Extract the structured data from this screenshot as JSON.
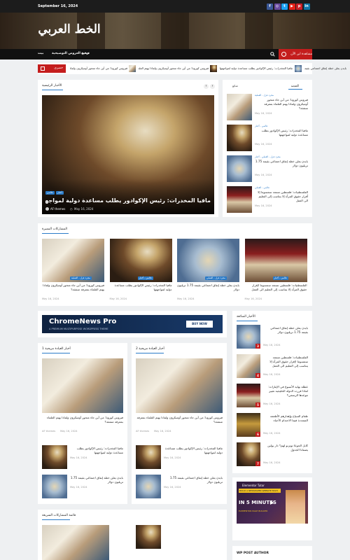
{
  "topbar": {
    "date": "September 16, 2024",
    "social": [
      {
        "icon": "facebook-icon",
        "glyph": "f",
        "color": "#3b5998"
      },
      {
        "icon": "instagram-icon",
        "glyph": "◎",
        "color": "#6a4ba0"
      },
      {
        "icon": "twitter-icon",
        "glyph": "t",
        "color": "#1da1f2"
      },
      {
        "icon": "youtube-icon",
        "glyph": "▶",
        "color": "#e62117"
      },
      {
        "icon": "pinterest-icon",
        "glyph": "p",
        "color": "#cb2027"
      },
      {
        "icon": "linkedin-icon",
        "glyph": "in",
        "color": "#0e76a8"
      }
    ]
  },
  "header": {
    "site_title": "الخط العربي"
  },
  "nav": {
    "items": [
      "بيت",
      "جميع العروض التوضيحية",
      "ترقية"
    ],
    "live_label": "مشاهدة ابن الآن"
  },
  "ticker": {
    "badge": "حصري",
    "items": [
      "فيروس كورونا: من أين جاء متحور أوميكرون ولماذا يهتم العلماء بمعرفة منشئه؟",
      "مافيا المخدرات: رئيس الإكوادور يطلب مساعدة دولية لمواجهتها",
      "بايدن يعلن خطة إنفاق اجتماعي بقيمة 1.75 تريليون دولار"
    ]
  },
  "main_news": {
    "section_title": "الأخبار الرئيسية",
    "categories": [
      "عالمي",
      "أخبار"
    ],
    "headline": "مافيا المخدرات: رئيس الإكوادور يطلب مساعدة دولية لمواجهتها",
    "author": "AF themes",
    "date": "May 16, 2024"
  },
  "tabs": {
    "labels": [
      "شائع",
      "أحدث"
    ],
    "items": [
      {
        "cat": "مجرد عزل - العملية",
        "title": "فيروس كورونا: من أين جاء متحور أوميكرون ولماذا يهتم العلماء بمعرفة منشئه؟",
        "date": "May 16, 2024"
      },
      {
        "cat": "عالمي - أخبار",
        "title": "مافيا المخدرات: رئيس الإكوادور يطلب مساعدة دولية لمواجهتها",
        "date": "May 16, 2024"
      },
      {
        "cat": "مجرد عزل - العملي - أخبار",
        "title": "بايدن يعلن خطة إنفاق اجتماعي بقيمة 1.75 تريليون دولار",
        "date": "May 16, 2024"
      },
      {
        "cat": "عالمي - العملي",
        "title": "الفلسطنيات: فلسطين تستعد سمسوما إلا أقرار حقوق المرأة إلا يتناسب إلى التعليم الى العمل",
        "date": "May 16, 2024"
      }
    ]
  },
  "featured": {
    "section_title": "المشاركات المميزة",
    "items": [
      {
        "cat": "مجرد عزل - العملية",
        "title": "فيروس كورونا: من أين جاء متحور أوميكرون ولماذا يهتم العلماء بمعرفة منشئه؟",
        "date": "May 16, 2024"
      },
      {
        "cat": "عالمي - أخبار",
        "title": "مافيا المخدرات: رئيس الإكوادور يطلب مساعدة دولية لمواجهتها",
        "date": "May 16, 2024"
      },
      {
        "cat": "مجرد عزل - العملي",
        "title": "بايدن يعلن خطة إنفاق اجتماعي بقيمة 1.75 تريليون دولار",
        "date": "May 16, 2024"
      },
      {
        "cat": "عالمي - أخبار",
        "title": "الفلسطنيات: فلسطين تستعد سمسوما لإقرار حقوق المرأة إلا يتناسب إلى التعليم الى العمل",
        "date": "May 16, 2024"
      }
    ]
  },
  "ad": {
    "brand": "ChromeNews Pro",
    "tagline": "A PREMIUM MULTIPURPOSE WORDPRESS THEME",
    "button": "BUY NOW"
  },
  "trending": {
    "section_title": "الأخبار الشائعة",
    "items": [
      {
        "num": "3",
        "title": "بايدن يعلن خطة إنفاق اجتماعي بقيمة 1.75 تريليون دولار",
        "date": "May 16, 2024"
      },
      {
        "num": "4",
        "title": "الفلسطنيات: فلسطين تستعد سمسوما لإقرار حقوق المرأة إلا يتناسب إلى التعليم الى العمل",
        "date": "May 16, 2024"
      },
      {
        "num": "5",
        "title": "عطلة نهاية الأسبوع في الإمارات: لماذا قررت الدولة الخليجية تغيير موعدها الرسمي؟",
        "date": "May 16, 2024"
      },
      {
        "num": "6",
        "title": "طعام السياح وإهدارهم الأطعمة المتعددة فيما الاحتدام الأحياء",
        "date": "May 16, 2024"
      },
      {
        "num": "7",
        "title": "كابل الجوعا توترنو لهم؟ دار يولين يضمانا الجدول",
        "date": "May 16, 2024"
      }
    ]
  },
  "column1": {
    "section_title": "أخبار العيادة مزيحية 1",
    "lead_title": "فيروس كورونا: من أين جاء متحور أوميكرون ولماذا يهتم العلماء بمعرفة منشئه؟",
    "author": "AF themes",
    "date": "May 16, 2024",
    "list": [
      {
        "title": "مافيا المخدرات: رئيس الإكوادور يطلب مساعدة دولية لمواجهتها",
        "date": "May 16, 2024"
      },
      {
        "title": "بايدن يعلن خطة إنفاق اجتماعي بقيمة 1.75 تريليون دولار",
        "date": "May 16, 2024"
      }
    ]
  },
  "column2": {
    "section_title": "أخبار العيادة مزيحية 2",
    "lead_title": "فيروس كورونا: من أين جاء متحور أوميكرون ولماذا يهتم العلماء بمعرفة منشئه؟",
    "author": "AF themes",
    "date": "May 16, 2024",
    "list": [
      {
        "title": "مافيا المخدرات: رئيس الإكوادور يطلب مساعدة دولية لمواجهتها",
        "date": "May 16, 2024"
      },
      {
        "title": "بايدن يعلن خطة إنفاق اجتماعي بقيمة 1.75 تريليون دولار",
        "date": "May 16, 2024"
      }
    ]
  },
  "video_ad": {
    "brand": "Elementor Tutor",
    "line1": "BUILD A NEWSPAPER WEBSITE FAST!",
    "big": "IN 5 MINUTES",
    "sub": "ELEMENTOR PAGE BUILDER"
  },
  "quick_list": {
    "section_title": "قائمة المشاركات السريعة"
  },
  "author_widget": {
    "title": "WP POST AUTHOR"
  }
}
